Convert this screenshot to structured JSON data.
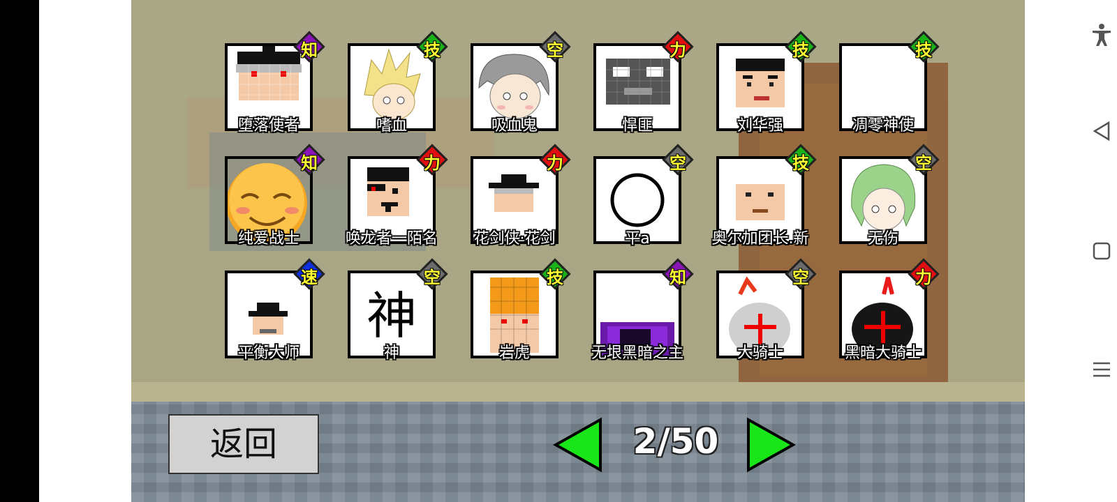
{
  "page_indicator": "2/50",
  "back_button": "返回",
  "prev_icon": "green-left-triangle",
  "next_icon": "green-right-triangle",
  "type_colors": {
    "知": "#8a14b8",
    "技": "#19b219",
    "空": "#6b6b6b",
    "力": "#e01010",
    "速": "#1030e0"
  },
  "characters": [
    {
      "name": "堕落使者",
      "type": "知",
      "portrait": "fallen-envoy"
    },
    {
      "name": "嗜血",
      "type": "技",
      "portrait": "bloodthirst-blonde"
    },
    {
      "name": "吸血鬼",
      "type": "空",
      "portrait": "vampire-gray-hair"
    },
    {
      "name": "悍匪",
      "type": "力",
      "portrait": "bandit-mask"
    },
    {
      "name": "刘华强",
      "type": "技",
      "portrait": "liu-huaqiang"
    },
    {
      "name": "凋零神使",
      "type": "技",
      "portrait": "blank"
    },
    {
      "name": "纯爱战士",
      "type": "知",
      "portrait": "smiley-emoji"
    },
    {
      "name": "唤龙者一陌名",
      "type": "力",
      "portrait": "dragon-caller"
    },
    {
      "name": "花剑侠·花剑",
      "type": "力",
      "portrait": "hat-swordsman"
    },
    {
      "name": "平a",
      "type": "空",
      "portrait": "circle"
    },
    {
      "name": "奥尔加团长.新",
      "type": "技",
      "portrait": "orga"
    },
    {
      "name": "无伤",
      "type": "空",
      "portrait": "green-hair-elf"
    },
    {
      "name": "平衡大师",
      "type": "速",
      "portrait": "balance-master"
    },
    {
      "name": "神",
      "type": "空",
      "portrait": "god-glyph"
    },
    {
      "name": "岩虎",
      "type": "技",
      "portrait": "orange-hair"
    },
    {
      "name": "无垠黑暗之主",
      "type": "知",
      "portrait": "purple-darkness"
    },
    {
      "name": "大骑士",
      "type": "空",
      "portrait": "white-knight"
    },
    {
      "name": "黑暗大骑士",
      "type": "力",
      "portrait": "dark-knight"
    }
  ],
  "system_nav": {
    "accessibility": "accessibility-icon",
    "back": "back-icon",
    "home": "home-icon",
    "menu": "menu-icon"
  }
}
